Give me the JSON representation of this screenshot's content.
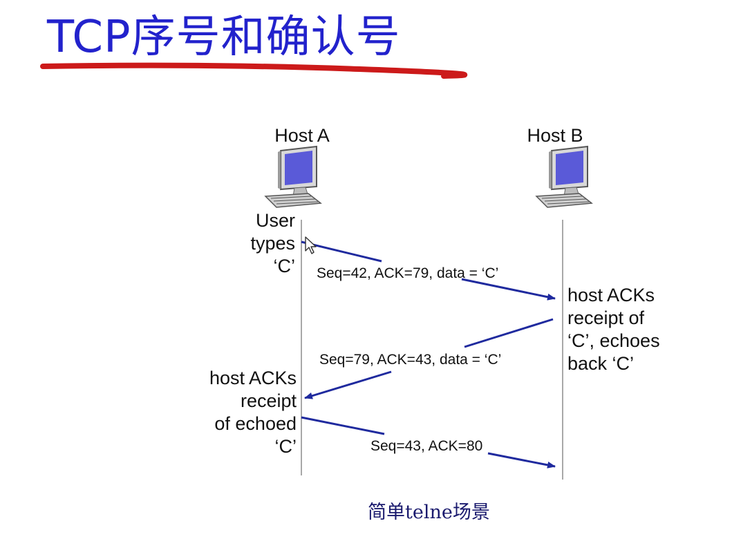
{
  "slide": {
    "title": "TCP序号和确认号",
    "caption": "简单telne场景"
  },
  "colors": {
    "title": "#2222cc",
    "underline": "#cc1a1a",
    "arrow": "#1f2a9e",
    "timeline": "#a8a8a8",
    "screen": "#5a5ad8",
    "caption": "#1a1a6e"
  },
  "hosts": {
    "a": {
      "label": "Host A",
      "icon": "desktop-computer-icon"
    },
    "b": {
      "label": "Host B",
      "icon": "desktop-computer-icon"
    }
  },
  "notes": {
    "user_types": [
      "User",
      "types",
      "‘C’"
    ],
    "b_acks": [
      "host ACKs",
      "receipt of",
      "‘C’, echoes",
      "back ‘C’"
    ],
    "a_acks": [
      "host ACKs",
      "receipt",
      "of echoed",
      "‘C’"
    ]
  },
  "messages": [
    {
      "label": "Seq=42, ACK=79, data = ‘C’",
      "from": "Host A",
      "to": "Host B"
    },
    {
      "label": "Seq=79, ACK=43, data = ‘C’",
      "from": "Host B",
      "to": "Host A"
    },
    {
      "label": "Seq=43, ACK=80",
      "from": "Host A",
      "to": "Host B"
    }
  ],
  "cursor": {
    "icon": "mouse-pointer-icon"
  }
}
